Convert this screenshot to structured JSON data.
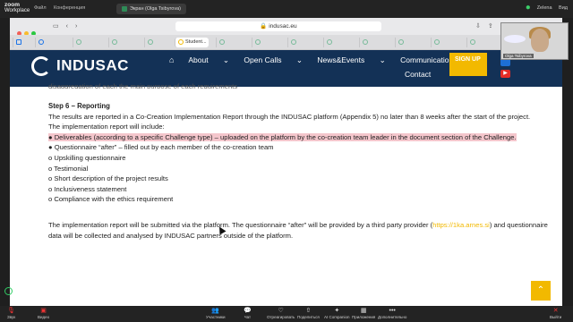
{
  "topbar": {
    "brand_line1": "zoom",
    "brand_line2": "Workplace",
    "menu1": "Файл",
    "menu2": "Конференция",
    "share_label": "Экран (Olga Tsibyrova)",
    "right_status": "Zelena",
    "right_label": "Вид"
  },
  "browser": {
    "url": "indusac.eu",
    "active_tab": "Student..."
  },
  "site": {
    "logo": "INDUSAC",
    "nav": [
      "About",
      "Open Calls",
      "News&Events",
      "Communication Toolkit"
    ],
    "nav_contact": "Contact",
    "signup": "SIGN UP"
  },
  "content": {
    "cut_line": "disaggregation of each the main purpose of each requirements",
    "heading": "Step 6 – Reporting",
    "p1": "The results are reported in a Co-Creation Implementation Report through the INDUSAC platform (Appendix 5) no later than 8 weeks after the start of the project.",
    "p2": "The implementation report will include:",
    "bullet_highlight": "● Deliverables (according to a specific Challenge type) – uploaded on the platform by the co-creation team leader in the document section of the Challenge.",
    "bullet2": "● Questionnaire “after” – filled out by each member of the co-creation team",
    "items": [
      "o Upskilling questionnaire",
      "o Testimonial",
      "o Short description of the project results",
      "o Inclusiveness statement",
      "o Compliance with the ethics requirement"
    ],
    "final_a": "The implementation report will be submitted via the platform. The questionnaire “after” will be provided by a third party provider (",
    "final_link": "https://1ka.arnes.si",
    "final_b": ") and questionnaire data will be collected and analysed by INDUSAC partners outside of the platform."
  },
  "camera": {
    "name": "Olga Tsibyrova"
  },
  "bottombar": {
    "left": [
      {
        "icon": "mic",
        "label": "Звук"
      },
      {
        "icon": "video",
        "label": "Видео"
      }
    ],
    "center": [
      {
        "icon": "people",
        "label": "Участники",
        "badge": "10"
      },
      {
        "icon": "chat",
        "label": "Чат"
      },
      {
        "icon": "react",
        "label": "Отреагировать"
      },
      {
        "icon": "share",
        "label": "Поделиться"
      },
      {
        "icon": "ai",
        "label": "AI Companion"
      },
      {
        "icon": "apps",
        "label": "Приложения"
      },
      {
        "icon": "more",
        "label": "Дополнительно"
      }
    ],
    "end": "Выйти"
  },
  "colors": {
    "navy": "#133156",
    "accent": "#f2b900",
    "highlight": "#f4c6cc"
  }
}
